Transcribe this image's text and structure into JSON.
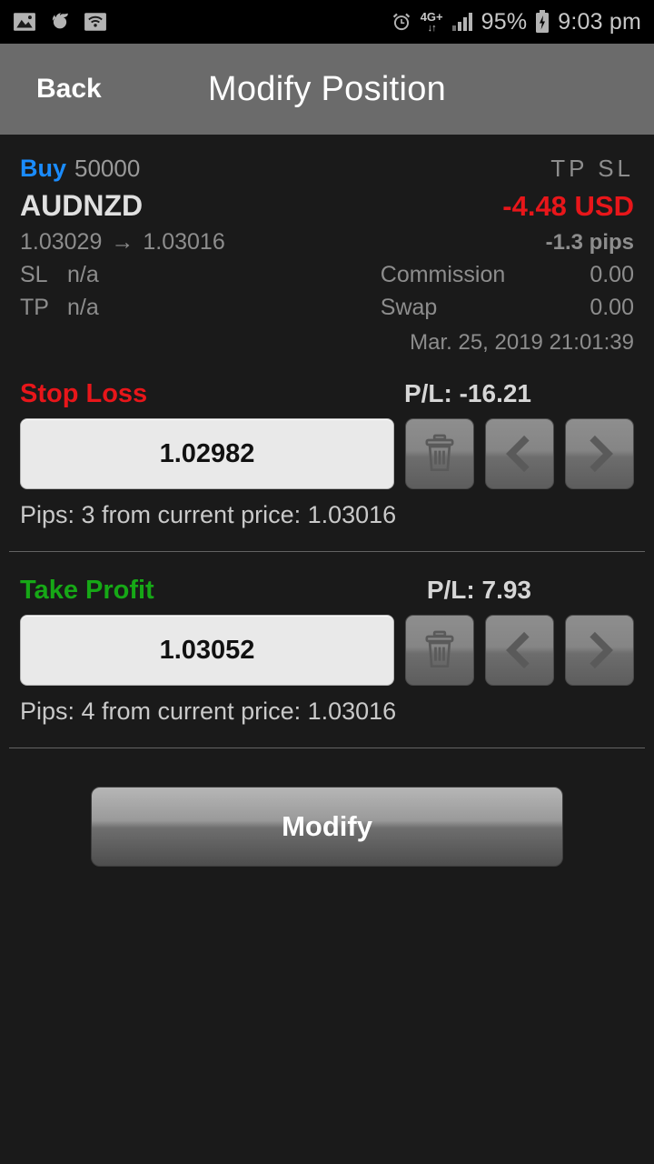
{
  "status_bar": {
    "left_icons": [
      "image-icon",
      "firefox-icon",
      "wifi-icon"
    ],
    "alarm_icon": "alarm-icon",
    "network_label": "4G+",
    "network_arrows": "↓↑",
    "signal_icon": "signal-bars-icon",
    "battery_percent": "95%",
    "battery_icon": "battery-charging-icon",
    "clock": "9:03 pm"
  },
  "header": {
    "back_label": "Back",
    "title": "Modify Position"
  },
  "position": {
    "direction": "Buy",
    "volume": "50000",
    "tp_sl_header": "TP  SL",
    "symbol": "AUDNZD",
    "profit": "-4.48 USD",
    "price_open": "1.03029",
    "price_arrow": "→",
    "price_current": "1.03016",
    "pips": "-1.3 pips",
    "sl_key": "SL",
    "sl_value": "n/a",
    "tp_key": "TP",
    "tp_value": "n/a",
    "commission_label": "Commission",
    "commission_value": "0.00",
    "swap_label": "Swap",
    "swap_value": "0.00",
    "datetime": "Mar. 25, 2019 21:01:39"
  },
  "stop_loss": {
    "title": "Stop Loss",
    "pl": "P/L: -16.21",
    "value": "1.02982",
    "hint": "Pips: 3 from current price: 1.03016",
    "delete_icon": "trash-icon",
    "decrement_icon": "chevron-left-icon",
    "increment_icon": "chevron-right-icon"
  },
  "take_profit": {
    "title": "Take Profit",
    "pl": "P/L: 7.93",
    "value": "1.03052",
    "hint": "Pips: 4 from current price: 1.03016",
    "delete_icon": "trash-icon",
    "decrement_icon": "chevron-left-icon",
    "increment_icon": "chevron-right-icon"
  },
  "actions": {
    "modify_label": "Modify"
  },
  "colors": {
    "buy_blue": "#1a8cff",
    "loss_red": "#e8161a",
    "profit_green": "#16a816",
    "header_gray": "#6b6b6b",
    "background": "#1a1a1a"
  }
}
